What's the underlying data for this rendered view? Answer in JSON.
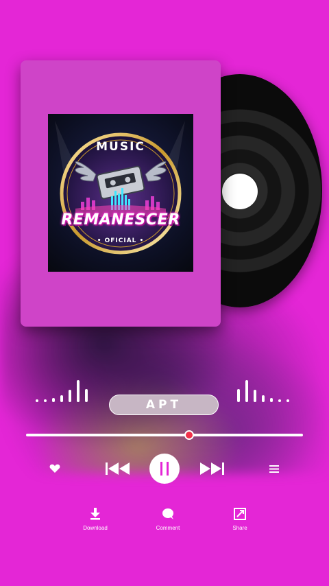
{
  "album": {
    "logo_top": "MUSIC",
    "logo_main": "REMANESCER",
    "logo_sub": "• OFICIAL •"
  },
  "player": {
    "song_title": "APT",
    "progress": 0.59,
    "accent_color": "#f0324a",
    "background_color": "#e426d6"
  },
  "controls": {
    "like_icon": "heart-icon",
    "prev_icon": "skip-previous-icon",
    "play_state_icon": "pause-icon",
    "next_icon": "skip-next-icon",
    "menu_icon": "list-menu-icon"
  },
  "actions": {
    "download_label": "Download",
    "comment_label": "Comment",
    "share_label": "Share"
  },
  "equalizer": {
    "left_levels": [
      0.12,
      0.12,
      0.18,
      0.3,
      0.55,
      1.0,
      0.6
    ],
    "right_levels": [
      0.6,
      1.0,
      0.55,
      0.3,
      0.18,
      0.12,
      0.12
    ]
  }
}
